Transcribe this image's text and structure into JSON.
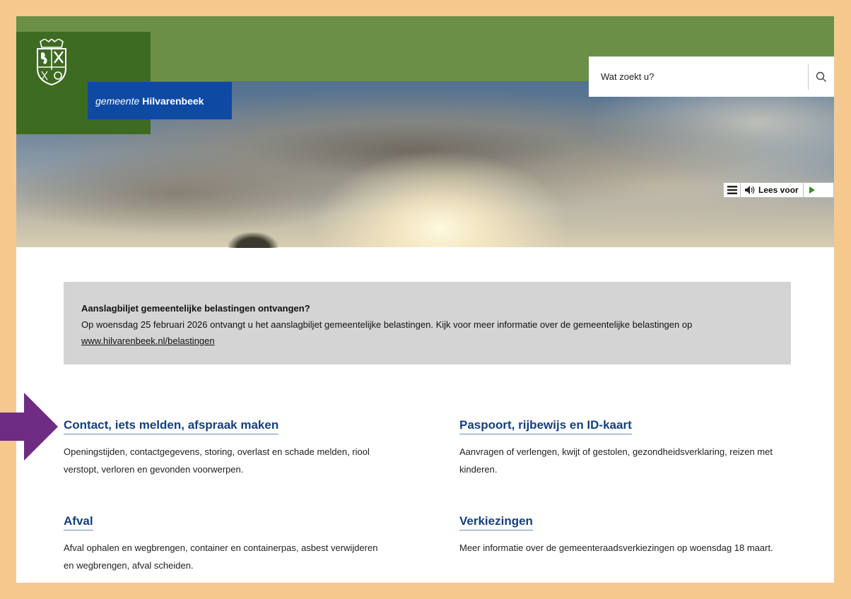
{
  "header": {
    "brand_prefix": "gemeente",
    "brand_name": "Hilvarenbeek",
    "search_placeholder": "Wat zoekt u?",
    "search_icon": "search-icon",
    "readspeaker": {
      "menu_icon": "menu-icon",
      "speaker_icon": "speaker-icon",
      "label": "Lees voor",
      "play_icon": "play-icon"
    }
  },
  "notice": {
    "title": "Aanslagbiljet gemeentelijke belastingen ontvangen?",
    "text": "Op woensdag 25 februari 2026 ontvangt u het aanslagbiljet gemeentelijke belastingen. Kijk voor meer informatie over de gemeentelijke belastingen op",
    "link": "www.hilvarenbeek.nl/belastingen"
  },
  "categories": [
    {
      "title": "Contact, iets melden, afspraak maken",
      "description": "Openingstijden, contactgegevens, storing, overlast en schade melden, riool verstopt, verloren en gevonden voorwerpen."
    },
    {
      "title": "Paspoort, rijbewijs en ID-kaart",
      "description": "Aanvragen of verlengen, kwijt of gestolen, gezondheidsverklaring, reizen met kinderen."
    },
    {
      "title": "Afval",
      "description": "Afval ophalen en wegbrengen, container en containerpas, asbest verwijderen en wegbrengen, afval scheiden."
    },
    {
      "title": "Verkiezingen",
      "description": "Meer informatie over de gemeenteraadsverkiezingen op woensdag 18 maart."
    }
  ],
  "colors": {
    "page_border": "#f5c98e",
    "header_green": "#6b8f47",
    "logo_green": "#3d6b22",
    "brand_blue": "#0e49a3",
    "link_blue": "#14407f",
    "notice_bg": "#d4d4d4",
    "arrow_purple": "#6e2c82"
  },
  "annotation": {
    "arrow_icon": "arrow-right-icon"
  }
}
